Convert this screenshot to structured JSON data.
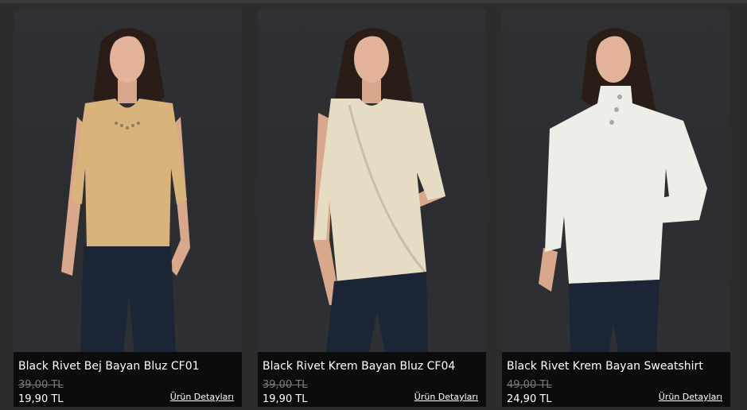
{
  "products": [
    {
      "title": "Black Rivet Bej Bayan Bluz CF01",
      "old_price": "39,00 TL",
      "new_price": "19,90 TL",
      "details_label": "Ürün Detayları",
      "garment_color": "#d8b37c"
    },
    {
      "title": "Black Rivet Krem Bayan Bluz CF04",
      "old_price": "39,00 TL",
      "new_price": "19,90 TL",
      "details_label": "Ürün Detayları",
      "garment_color": "#e6dcc4"
    },
    {
      "title": "Black Rivet Krem Bayan Sweatshirt",
      "old_price": "49,00 TL",
      "new_price": "24,90 TL",
      "details_label": "Ürün Detayları",
      "garment_color": "#eeeee8"
    }
  ]
}
